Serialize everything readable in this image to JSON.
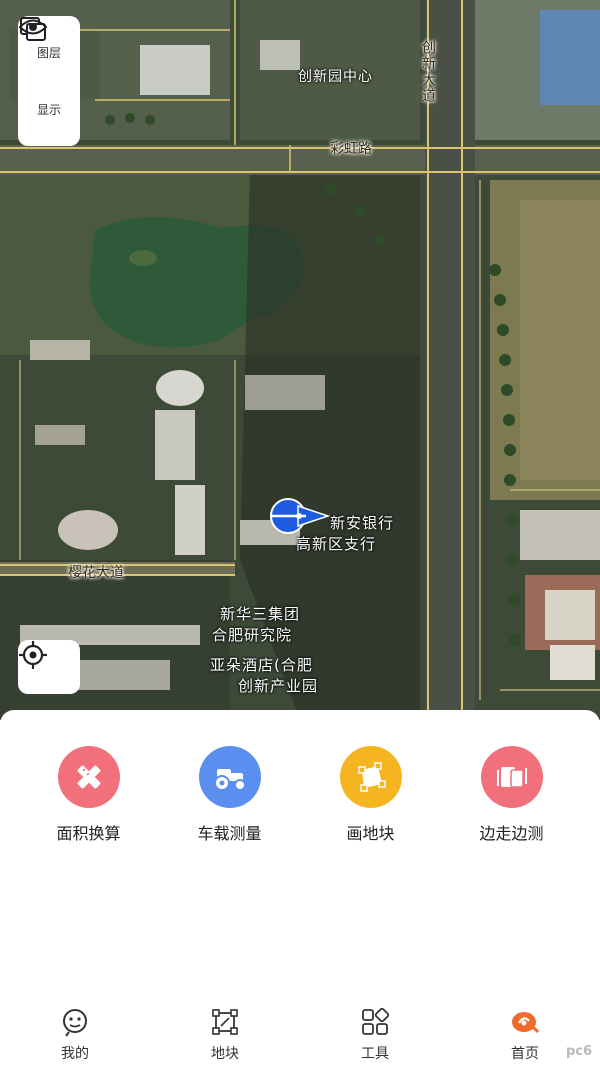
{
  "map": {
    "controls": {
      "layers_label": "图层",
      "display_label": "显示"
    },
    "poi_labels": {
      "bank_line1": "新安银行",
      "bank_line2": "高新区支行",
      "institute_line1": "新华三集团",
      "institute_line2": "合肥研究院",
      "hotel_line1": "亚朵酒店(合肥",
      "hotel_line2": "创新产业园",
      "park": "创新园中心"
    },
    "road_labels": {
      "caihong_road": "彩虹路",
      "chuangxin_avenue": "创新大道",
      "yinghua_avenue": "樱花大道"
    }
  },
  "tools": [
    {
      "label": "面积换算",
      "icon": "ruler-pencil-icon",
      "color": "#f2707c"
    },
    {
      "label": "车载测量",
      "icon": "tractor-icon",
      "color": "#5b8fef"
    },
    {
      "label": "画地块",
      "icon": "draw-plot-icon",
      "color": "#f5b521"
    },
    {
      "label": "边走边测",
      "icon": "walk-measure-icon",
      "color": "#f2707c"
    }
  ],
  "tabbar": {
    "tabs": [
      {
        "label": "我的",
        "icon": "profile-icon"
      },
      {
        "label": "地块",
        "icon": "plot-icon"
      },
      {
        "label": "工具",
        "icon": "tools-grid-icon"
      },
      {
        "label": "首页",
        "icon": "home-icon",
        "accent": "#ef6b2c"
      }
    ]
  },
  "watermark": "pc6"
}
